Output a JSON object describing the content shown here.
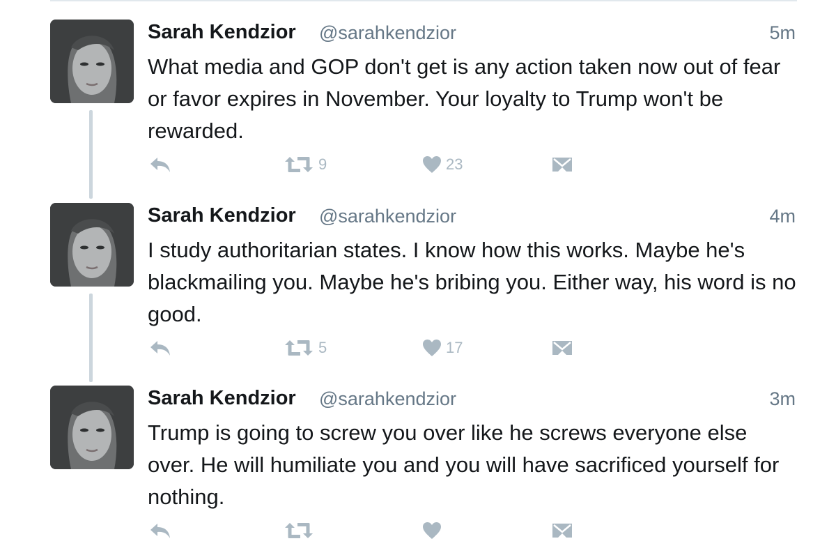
{
  "tweets": [
    {
      "name": "Sarah Kendzior",
      "handle": "@sarahkendzior",
      "time": "5m",
      "text": "What media and GOP don't get is any action taken now out of fear or favor expires in November. Your loyalty to Trump won't be rewarded.",
      "retweets": "9",
      "likes": "23"
    },
    {
      "name": "Sarah Kendzior",
      "handle": "@sarahkendzior",
      "time": "4m",
      "text": "I study authoritarian states. I know how this works. Maybe he's blackmailing you. Maybe he's bribing you. Either way, his word is no good.",
      "retweets": "5",
      "likes": "17"
    },
    {
      "name": "Sarah Kendzior",
      "handle": "@sarahkendzior",
      "time": "3m",
      "text": "Trump is going to screw you over like he screws everyone else over. He will humiliate you and you will have sacrificed yourself for nothing.",
      "retweets": "",
      "likes": ""
    }
  ],
  "icons": {
    "reply": "reply-icon",
    "retweet": "retweet-icon",
    "like": "heart-icon",
    "message": "direct-message-icon"
  },
  "colors": {
    "text": "#14171a",
    "secondary": "#657786",
    "icon": "#aab8c2",
    "thread_line": "#ccd6dd"
  }
}
